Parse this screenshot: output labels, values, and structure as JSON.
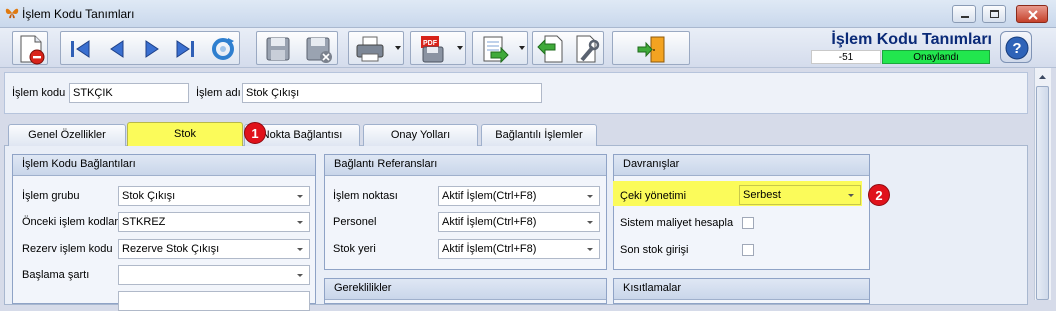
{
  "window": {
    "title": "İşlem Kodu Tanımları"
  },
  "header": {
    "title": "İşlem Kodu Tanımları",
    "number": "-51",
    "status": "Onaylandı"
  },
  "fields": {
    "islem_kodu_label": "İşlem kodu",
    "islem_kodu_value": "STKÇIK",
    "islem_adi_label": "İşlem adı",
    "islem_adi_value": "Stok Çıkışı"
  },
  "tabs": [
    "Genel Özellikler",
    "Stok",
    "Nokta Bağlantısı",
    "Onay Yolları",
    "Bağlantılı İşlemler"
  ],
  "groups": {
    "baglantilar": {
      "title": "İşlem Kodu Bağlantıları",
      "rows": [
        {
          "label": "İşlem grubu",
          "value": "Stok Çıkışı"
        },
        {
          "label": "Önceki işlem kodları",
          "value": "STKREZ"
        },
        {
          "label": "Rezerv işlem kodu",
          "value": "Rezerve Stok Çıkışı"
        },
        {
          "label": "Başlama şartı",
          "value": ""
        }
      ]
    },
    "referanslar": {
      "title": "Bağlantı Referansları",
      "rows": [
        {
          "label": "İşlem noktası",
          "value": "Aktif İşlem(Ctrl+F8)"
        },
        {
          "label": "Personel",
          "value": "Aktif İşlem(Ctrl+F8)"
        },
        {
          "label": "Stok yeri",
          "value": "Aktif İşlem(Ctrl+F8)"
        }
      ]
    },
    "davranislar": {
      "title": "Davranışlar",
      "ceki_label": "Çeki yönetimi",
      "ceki_value": "Serbest",
      "maliyet_label": "Sistem maliyet hesapla",
      "son_stok_label": "Son stok girişi"
    },
    "gereklilikler": {
      "title": "Gereklilikler"
    },
    "kisitlamalar": {
      "title": "Kısıtlamalar"
    }
  },
  "badges": {
    "one": "1",
    "two": "2"
  },
  "colors": {
    "highlight": "#fbfb5a",
    "status_green": "#22e64e",
    "badge_red": "#e0121b",
    "title_blue": "#0a2a78"
  },
  "icons": [
    "new-document-icon",
    "first-record-icon",
    "previous-record-icon",
    "next-record-icon",
    "last-record-icon",
    "refresh-icon",
    "save-icon",
    "delete-save-icon",
    "print-icon",
    "pdf-icon",
    "export-icon",
    "import-icon",
    "settings-tool-icon",
    "exit-door-icon",
    "help-icon"
  ]
}
